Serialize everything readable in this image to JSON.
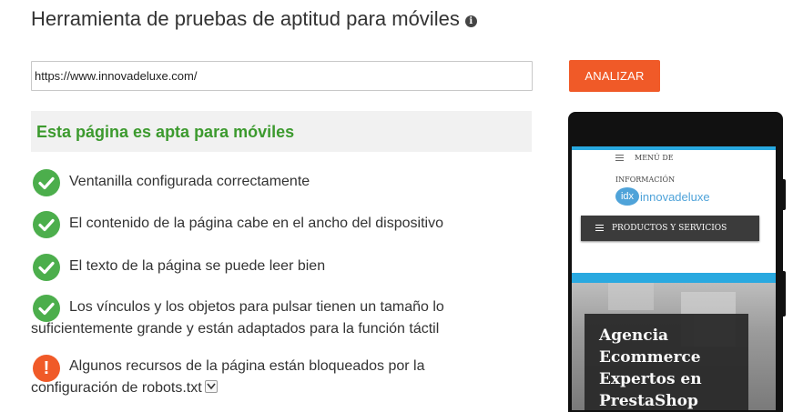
{
  "header": {
    "title": "Herramienta de pruebas de aptitud para móviles",
    "info_glyph": "i"
  },
  "form": {
    "url_value": "https://www.innovadeluxe.com/",
    "analyze_label": "ANALIZAR"
  },
  "result": {
    "title": "Esta página es apta para móviles",
    "title_color": "#3c9a2e",
    "checks": [
      {
        "status": "ok",
        "text": "Ventanilla configurada correctamente"
      },
      {
        "status": "ok",
        "text": "El contenido de la página cabe en el ancho del dispositivo"
      },
      {
        "status": "ok",
        "text": "El texto de la página se puede leer bien"
      },
      {
        "status": "ok",
        "text": "Los vínculos y los objetos para pulsar tienen un tamaño lo suficientemente grande y están adaptados para la función táctil"
      },
      {
        "status": "warning",
        "text": "Algunos recursos de la página están bloqueados por la configuración de robots.txt",
        "warning_glyph": "!"
      }
    ]
  },
  "preview": {
    "menu_label": "MENÚ DE",
    "info_label": "INFORMACIÓN",
    "logo_badge": "idx",
    "logo_text": "innovadeluxe",
    "products_label": "PRODUCTOS Y SERVICIOS",
    "hero_title": "Agencia Ecommerce Expertos en PrestaShop"
  },
  "colors": {
    "accent": "#f05a28",
    "success": "#4cae4c",
    "warning": "#f05a28",
    "preview_blue": "#29a9e0"
  }
}
